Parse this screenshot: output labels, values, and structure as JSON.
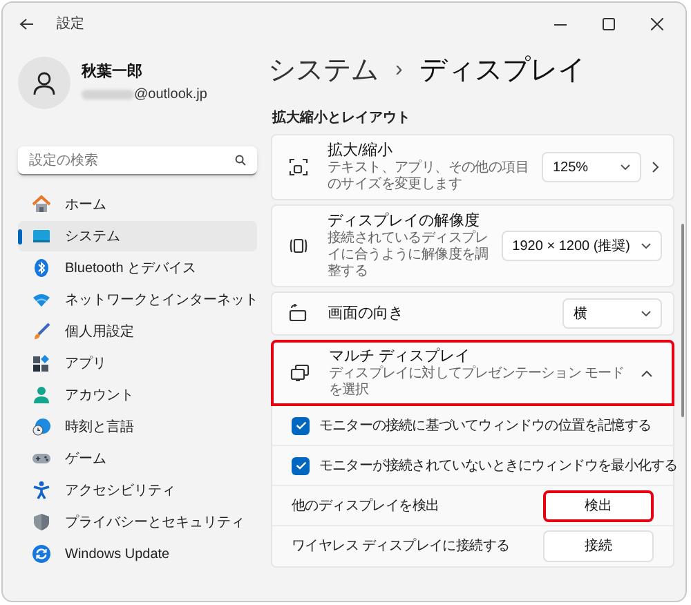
{
  "window": {
    "title": "設定"
  },
  "account": {
    "name": "秋葉一郎",
    "email": "@outlook.jp"
  },
  "search": {
    "placeholder": "設定の検索"
  },
  "sidebar": {
    "items": [
      {
        "label": "ホーム",
        "kind": "home",
        "selected": false
      },
      {
        "label": "システム",
        "kind": "system",
        "selected": true
      },
      {
        "label": "Bluetooth とデバイス",
        "kind": "bluetooth",
        "selected": false
      },
      {
        "label": "ネットワークとインターネット",
        "kind": "network",
        "selected": false
      },
      {
        "label": "個人用設定",
        "kind": "personalization",
        "selected": false
      },
      {
        "label": "アプリ",
        "kind": "apps",
        "selected": false
      },
      {
        "label": "アカウント",
        "kind": "accounts",
        "selected": false
      },
      {
        "label": "時刻と言語",
        "kind": "time",
        "selected": false
      },
      {
        "label": "ゲーム",
        "kind": "gaming",
        "selected": false
      },
      {
        "label": "アクセシビリティ",
        "kind": "accessibility",
        "selected": false
      },
      {
        "label": "プライバシーとセキュリティ",
        "kind": "privacy",
        "selected": false
      },
      {
        "label": "Windows Update",
        "kind": "update",
        "selected": false
      }
    ]
  },
  "breadcrumb": {
    "parent": "システム",
    "separator": "›",
    "current": "ディスプレイ"
  },
  "section": {
    "title": "拡大縮小とレイアウト"
  },
  "settings": [
    {
      "kind": "dropdown",
      "title": "拡大/縮小",
      "description": "テキスト、アプリ、その他の項目のサイズを変更します",
      "value": "125%",
      "chevron": true
    },
    {
      "kind": "dropdown",
      "title": "ディスプレイの解像度",
      "description": "接続されているディスプレイに合うように解像度を調整する",
      "value": "1920 × 1200 (推奨)",
      "chevron": false
    },
    {
      "kind": "dropdown",
      "title": "画面の向き",
      "value": "横",
      "chevron": false
    },
    {
      "kind": "expander",
      "title": "マルチ ディスプレイ",
      "description": "ディスプレイに対してプレゼンテーション モードを選択",
      "expanded": true,
      "highlighted": true,
      "children": [
        {
          "kind": "checkbox",
          "label": "モニターの接続に基づいてウィンドウの位置を記憶する",
          "checked": true
        },
        {
          "kind": "checkbox",
          "label": "モニターが接続されていないときにウィンドウを最小化する",
          "checked": true
        },
        {
          "kind": "button",
          "label": "他のディスプレイを検出",
          "button": "検出",
          "highlighted": true
        },
        {
          "kind": "button",
          "label": "ワイヤレス ディスプレイに接続する",
          "button": "接続",
          "highlighted": false
        }
      ]
    }
  ]
}
